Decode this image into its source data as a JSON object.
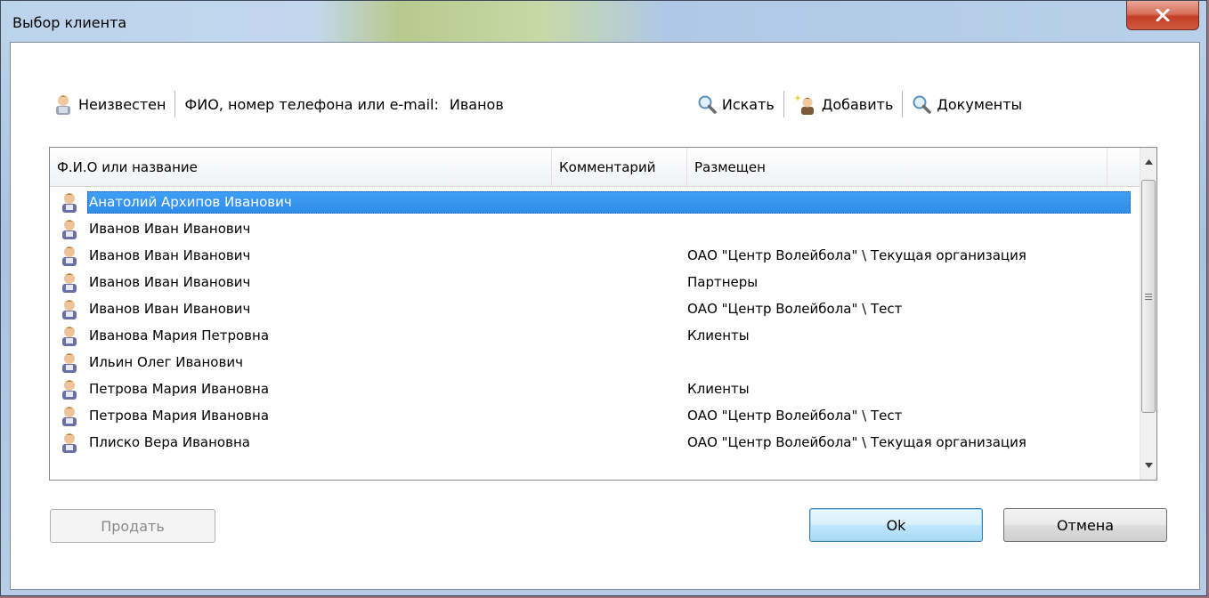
{
  "window": {
    "title": "Выбор клиента"
  },
  "toolbar": {
    "unknown_label": "Неизвестен",
    "search_label": "ФИО, номер телефона или e-mail:",
    "search_value": "Иванов",
    "search_button": "Искать",
    "add_button": "Добавить",
    "documents_button": "Документы"
  },
  "grid": {
    "columns": [
      "Ф.И.О или название",
      "Комментарий",
      "Размещен"
    ],
    "rows": [
      {
        "name": "Анатолий Архипов Иванович",
        "comment": "",
        "placed": "",
        "selected": true
      },
      {
        "name": "Иванов Иван Иванович",
        "comment": "",
        "placed": ""
      },
      {
        "name": "Иванов Иван Иванович",
        "comment": "",
        "placed": "ОАО \"Центр Волейбола\" \\ Текущая организация"
      },
      {
        "name": "Иванов Иван Иванович",
        "comment": "",
        "placed": "Партнеры"
      },
      {
        "name": "Иванов Иван Иванович",
        "comment": "",
        "placed": "ОАО \"Центр Волейбола\" \\ Тест"
      },
      {
        "name": "Иванова Мария Петровна",
        "comment": "",
        "placed": "Клиенты"
      },
      {
        "name": "Ильин Олег Иванович",
        "comment": "",
        "placed": ""
      },
      {
        "name": "Петрова Мария Ивановна",
        "comment": "",
        "placed": "Клиенты"
      },
      {
        "name": "Петрова Мария Ивановна",
        "comment": "",
        "placed": "ОАО \"Центр Волейбола\" \\ Тест"
      },
      {
        "name": "Плиско Вера Ивановна",
        "comment": "",
        "placed": "ОАО \"Центр Волейбола\" \\ Текущая организация"
      }
    ]
  },
  "buttons": {
    "sell": "Продать",
    "ok": "Ok",
    "cancel": "Отмена"
  },
  "icons": {
    "user": "user-icon",
    "search": "magnifier-icon",
    "add_user": "add-user-icon",
    "close": "close-icon"
  }
}
